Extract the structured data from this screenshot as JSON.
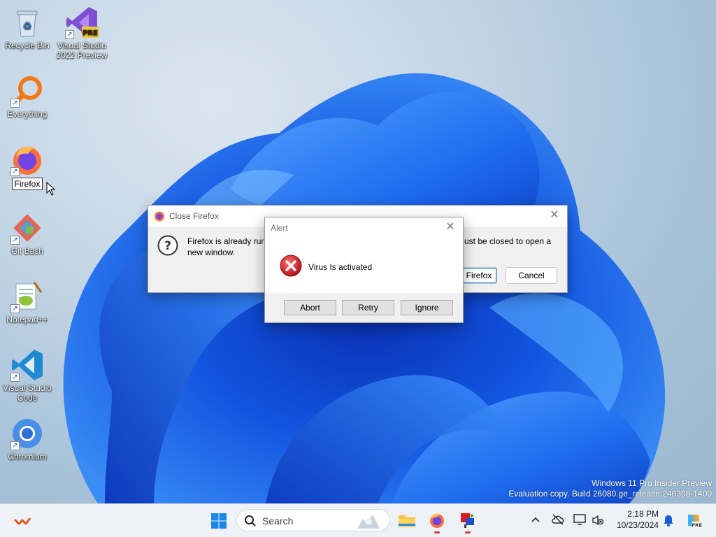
{
  "desktop": {
    "icons": [
      {
        "label": "Recycle Bin",
        "icon": "recycle-bin-icon"
      },
      {
        "label": "Visual Studio 2022 Preview",
        "badge": "PRE",
        "icon": "visual-studio-preview-icon"
      },
      {
        "label": "Everything",
        "icon": "everything-search-icon"
      },
      {
        "label": "Firefox",
        "icon": "firefox-icon",
        "renaming": true
      },
      {
        "label": "Git Bash",
        "icon": "git-bash-icon"
      },
      {
        "label": "Notepad++",
        "icon": "notepad-plus-plus-icon"
      },
      {
        "label": "Visual Studio Code",
        "icon": "vscode-icon"
      },
      {
        "label": "Chromium",
        "icon": "chromium-icon"
      }
    ],
    "watermark": {
      "line1": "Windows 11 Pro Insider Preview",
      "line2": "Evaluation copy. Build 26080.ge_release.240308-1400"
    }
  },
  "close_firefox_dialog": {
    "title": "Close Firefox",
    "message_left": "Firefox is already runn",
    "message_right": "ust be closed to open a",
    "message_line2": "new window.",
    "close_button_label": "e Firefox",
    "cancel_label": "Cancel",
    "icon": "question-icon"
  },
  "alert_dialog": {
    "title": "Alert",
    "message": "Virus Is activated",
    "icon": "error-icon",
    "buttons": {
      "abort": "Abort",
      "retry": "Retry",
      "ignore": "Ignore"
    }
  },
  "taskbar": {
    "search_placeholder": "Search",
    "clock_time": "2:18 PM",
    "clock_date": "10/23/2024",
    "accent": "#0078d4"
  }
}
